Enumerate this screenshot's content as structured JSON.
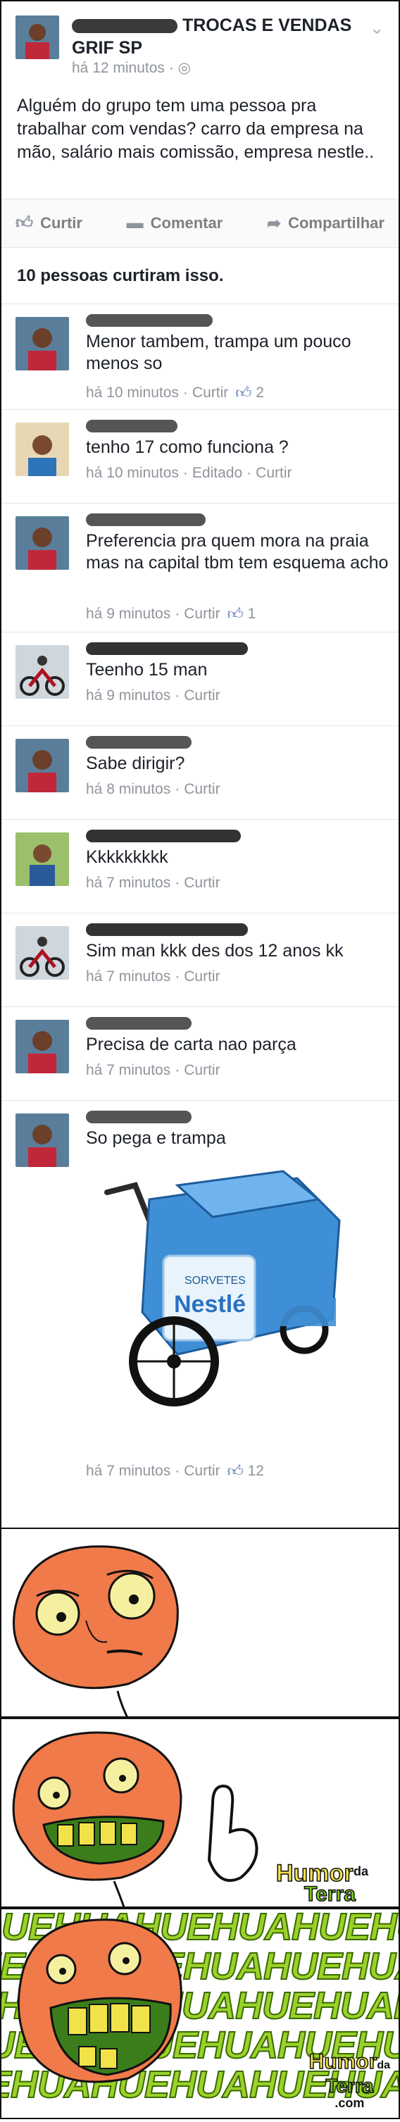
{
  "post": {
    "group_name": "TROCAS E VENDAS GRIF SP",
    "time": "há 12 minutos",
    "text": "Alguém do grupo tem uma pessoa pra trabalhar com vendas? carro da empresa na mão, salário mais comissão, empresa nestle..",
    "actions": {
      "like": "Curtir",
      "comment": "Comentar",
      "share": "Compartilhar"
    },
    "likes_summary": "10 pessoas curtiram isso."
  },
  "comments": [
    {
      "text": "Menor tambem, trampa um pouco menos so",
      "time": "há 10 minutos",
      "like_label": "Curtir",
      "likes": "2",
      "edited": ""
    },
    {
      "text": "tenho 17 como funciona ?",
      "time": "há 10 minutos",
      "like_label": "Curtir",
      "likes": "",
      "edited": "Editado"
    },
    {
      "text": "Preferencia pra quem mora na praia mas na capital tbm tem esquema acho",
      "time": "há 9 minutos",
      "like_label": "Curtir",
      "likes": "1",
      "edited": ""
    },
    {
      "text": "Teenho 15 man",
      "time": "há 9 minutos",
      "like_label": "Curtir",
      "likes": "",
      "edited": ""
    },
    {
      "text": "Sabe dirigir?",
      "time": "há 8 minutos",
      "like_label": "Curtir",
      "likes": "",
      "edited": ""
    },
    {
      "text": "Kkkkkkkkk",
      "time": "há 7 minutos",
      "like_label": "Curtir",
      "likes": "",
      "edited": ""
    },
    {
      "text": "Sim man kkk des dos 12 anos kk",
      "time": "há 7 minutos",
      "like_label": "Curtir",
      "likes": "",
      "edited": ""
    },
    {
      "text": "Precisa de carta nao parça",
      "time": "há 7 minutos",
      "like_label": "Curtir",
      "likes": "",
      "edited": ""
    },
    {
      "text": "So pega e trampa",
      "time": "há 7 minutos",
      "like_label": "Curtir",
      "likes": "12",
      "edited": ""
    }
  ],
  "cart_image": {
    "brand_label": "Nestlé",
    "sub_label": "SORVETES"
  },
  "meme": {
    "laugh_text": "UEHUAHUEHUAHUEHUAHUEHUAHUEHAUHEUAHEHAUHEAUEAUEHAUHEUAHEHAUHEUAHEUAHE",
    "watermark_line1": "Humor",
    "watermark_line2": "da",
    "watermark_line3": "Terra",
    "watermark_line4": ".com"
  },
  "colors": {
    "link": "#4267b2",
    "meta": "#90949c",
    "laugh": "#9bd12a",
    "face": "#f07a4a"
  }
}
